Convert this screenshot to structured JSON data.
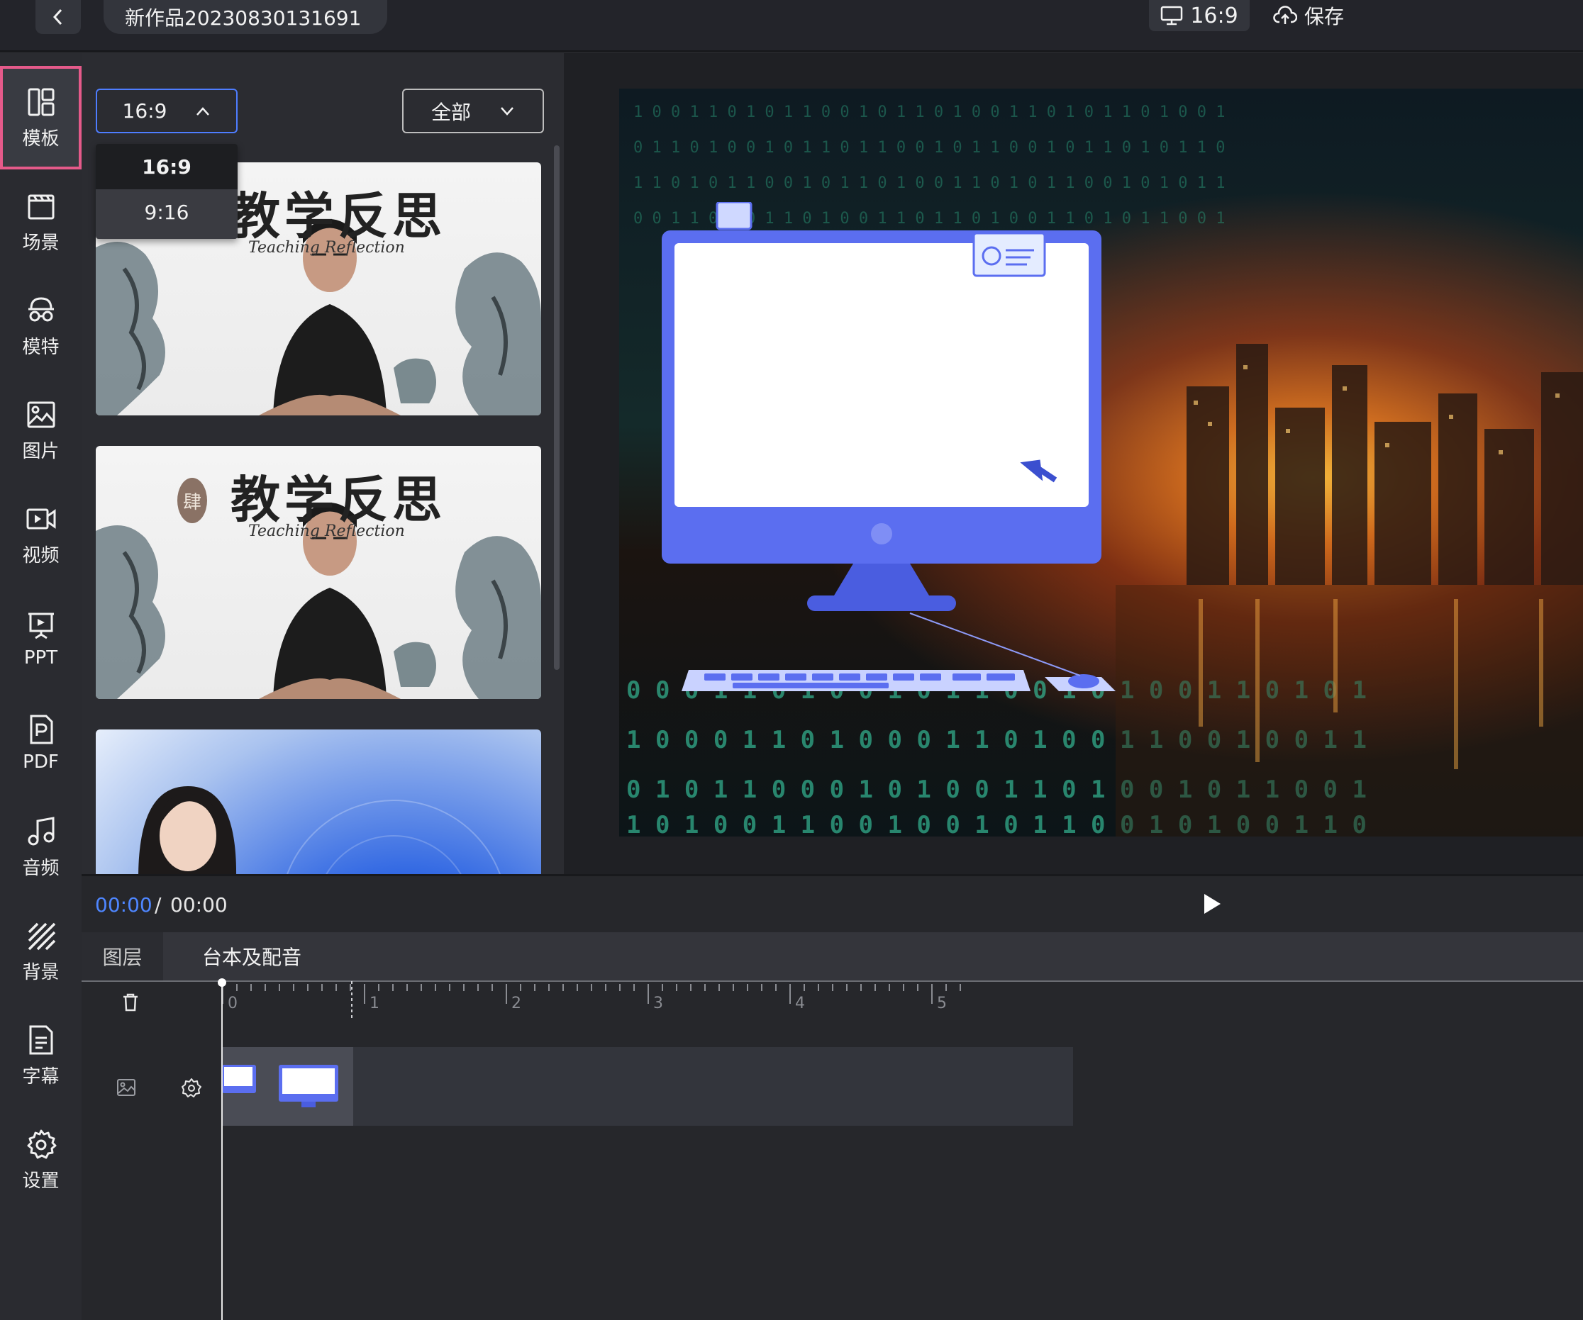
{
  "topbar": {
    "project_title": "新作品20230830131691",
    "aspect_label": "16:9",
    "save_label": "保存"
  },
  "sidebar": {
    "items": [
      {
        "label": "模板",
        "icon": "layout-icon",
        "active": true
      },
      {
        "label": "场景",
        "icon": "clapper-icon"
      },
      {
        "label": "模特",
        "icon": "avatar-icon"
      },
      {
        "label": "图片",
        "icon": "image-icon"
      },
      {
        "label": "视频",
        "icon": "video-icon"
      },
      {
        "label": "PPT",
        "icon": "presentation-icon"
      },
      {
        "label": "PDF",
        "icon": "pdf-icon"
      },
      {
        "label": "音频",
        "icon": "music-icon"
      },
      {
        "label": "背景",
        "icon": "background-icon"
      },
      {
        "label": "字幕",
        "icon": "subtitle-icon"
      },
      {
        "label": "设置",
        "icon": "settings-icon"
      }
    ]
  },
  "panel": {
    "ratio_select": {
      "value": "16:9",
      "options": [
        "16:9",
        "9:16"
      ],
      "expanded": true
    },
    "category_select": {
      "value": "全部"
    },
    "templates": [
      {
        "style": "ink-wash",
        "calligraphy": "教学反思",
        "subtitle": "Teaching Reflection"
      },
      {
        "style": "ink-wash",
        "calligraphy": "教学反思",
        "subtitle": "Teaching Reflection",
        "seal": "肆"
      },
      {
        "style": "blue-gradient"
      }
    ]
  },
  "transport": {
    "current_time": "00:00",
    "separator": "/",
    "total_time": "00:00"
  },
  "timeline": {
    "tabs": [
      "图层",
      "台本及配音"
    ],
    "ruler_labels": [
      "0",
      "1",
      "2",
      "3",
      "4",
      "5"
    ]
  },
  "colors": {
    "accent_blue": "#4e86ff",
    "active_outline": "#e55a8a",
    "monitor_blue": "#5b6ef0"
  }
}
